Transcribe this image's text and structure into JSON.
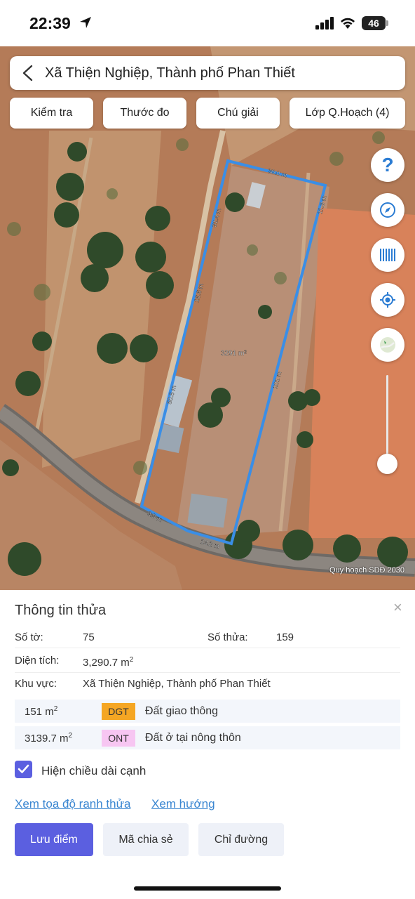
{
  "status_bar": {
    "time": "22:39",
    "battery": "46"
  },
  "map": {
    "search_title": "Xã Thiện Nghiệp, Thành phố Phan Thiết",
    "tools": [
      "Kiểm tra",
      "Thước đo",
      "Chú giải",
      "Lớp Q.Hoạch (4)"
    ],
    "edge_labels": [
      "30.0 m",
      "11.3 m",
      "31.4 m",
      "16.6 m",
      "50.5 m",
      "101 m",
      "9.9 m",
      "13.2 m"
    ],
    "area_label": "3291 m²",
    "attribution": "Quy hoạch SDĐ 2030",
    "controls": [
      "help-icon",
      "compass-icon",
      "barcode-icon",
      "locate-icon",
      "map-layer-icon",
      "zoom-slider"
    ],
    "boundary_color": "#3a8ee6"
  },
  "panel": {
    "title": "Thông tin thửa",
    "close": "×",
    "sheet_label": "Số tờ:",
    "sheet_value": "75",
    "parcel_label": "Số thửa:",
    "parcel_value": "159",
    "area_label": "Diện tích:",
    "area_value": "3,290.7 m",
    "area_unit_sup": "2",
    "region_label": "Khu vực:",
    "region_value": "Xã Thiện Nghiệp, Thành phố Phan Thiết",
    "land_uses": [
      {
        "area": "151 m",
        "sup": "2",
        "code": "DGT",
        "code_color": "#f5a623",
        "desc": "Đất giao thông"
      },
      {
        "area": "3139.7 m",
        "sup": "2",
        "code": "ONT",
        "code_color": "#f7c6f2",
        "desc": "Đất ở tại nông thôn"
      }
    ],
    "show_edge_lengths": "Hiện chiều dài cạnh",
    "show_edge_checked": true,
    "link_coords": "Xem tọa độ ranh thửa",
    "link_direction": "Xem hướng",
    "btn_save": "Lưu điểm",
    "btn_share": "Mã chia sẻ",
    "btn_route": "Chỉ đường",
    "accent_color": "#5b5fe0"
  }
}
